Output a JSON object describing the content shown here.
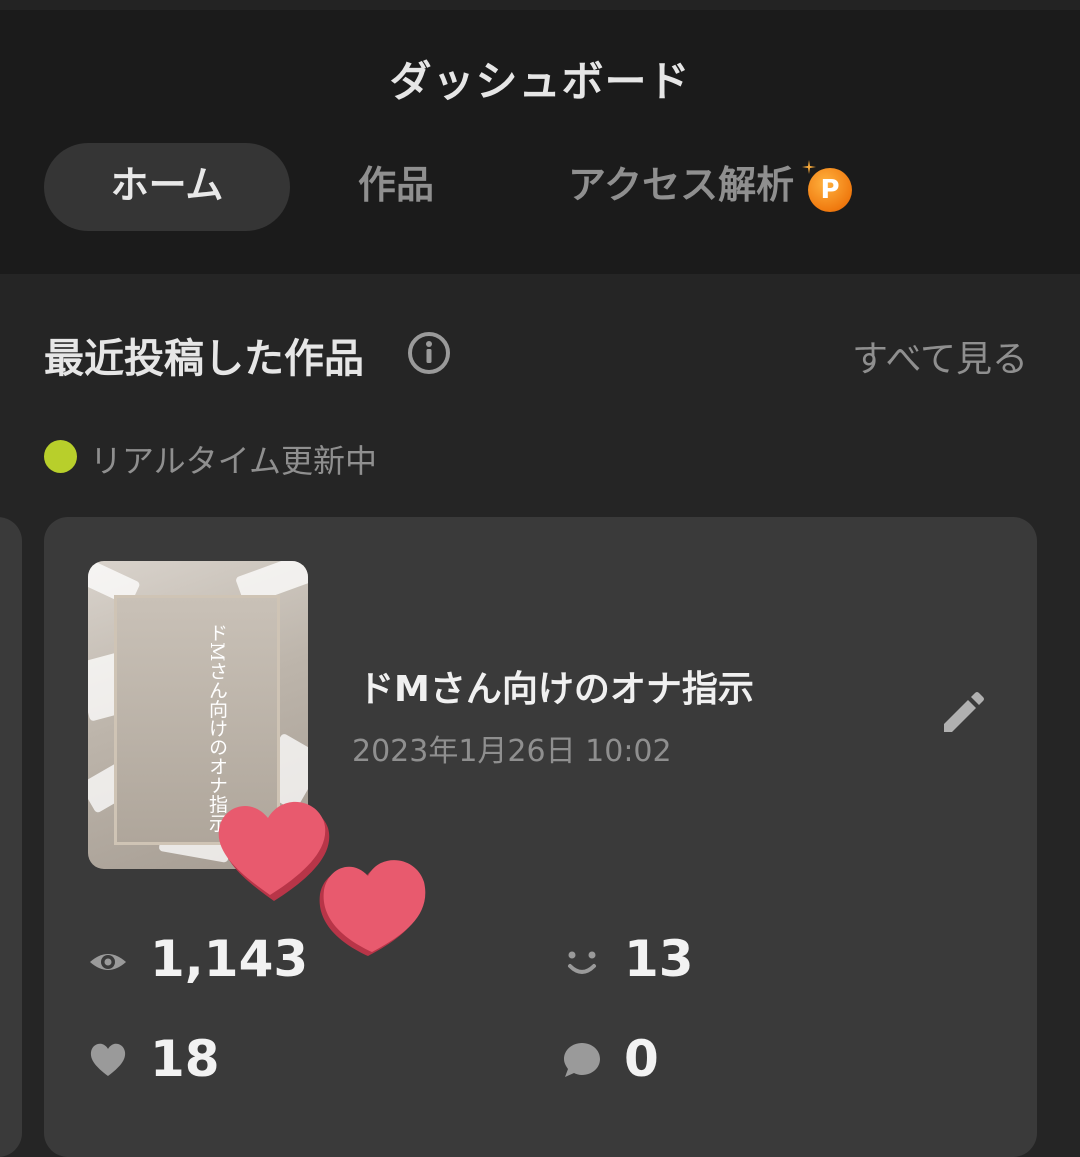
{
  "header": {
    "title": "ダッシュボード"
  },
  "tabs": [
    {
      "label": "ホーム",
      "active": true
    },
    {
      "label": "作品",
      "active": false
    },
    {
      "label": "アクセス解析",
      "badge": "P"
    }
  ],
  "section": {
    "title": "最近投稿した作品",
    "see_all_label": "すべて見る",
    "realtime_label": "リアルタイム更新中"
  },
  "work": {
    "title": "ドMさん向けのオナ指示",
    "date": "2023年1月26日 10:02",
    "cover_text": "ドMさん向けのオナ指示",
    "stats": {
      "views": "1,143",
      "reactions": "13",
      "likes": "18",
      "comments": "0"
    }
  },
  "colors": {
    "background": "#252525",
    "header": "#1b1b1b",
    "card": "#3a3a3a",
    "realtime_dot": "#b8cf2b",
    "badge": "#f07a0f",
    "heart": "#e85a6e"
  },
  "icons": [
    "info-icon",
    "pencil-icon",
    "eye-icon",
    "smile-icon",
    "heart-icon",
    "speech-bubble-icon"
  ]
}
